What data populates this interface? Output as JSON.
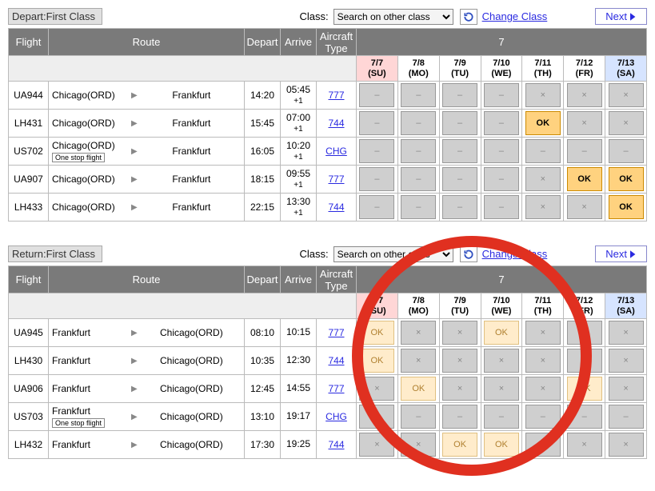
{
  "common": {
    "class_label": "Class:",
    "class_select": "Search on other class",
    "change_class": "Change Class",
    "next": "Next"
  },
  "month_header": "7",
  "dates": [
    {
      "md": "7/7",
      "dow": "(SU)",
      "cls": "date-su"
    },
    {
      "md": "7/8",
      "dow": "(MO)",
      "cls": ""
    },
    {
      "md": "7/9",
      "dow": "(TU)",
      "cls": ""
    },
    {
      "md": "7/10",
      "dow": "(WE)",
      "cls": ""
    },
    {
      "md": "7/11",
      "dow": "(TH)",
      "cls": ""
    },
    {
      "md": "7/12",
      "dow": "(FR)",
      "cls": ""
    },
    {
      "md": "7/13",
      "dow": "(SA)",
      "cls": "date-sa"
    }
  ],
  "headers": {
    "flight": "Flight",
    "route": "Route",
    "depart": "Depart",
    "arrive": "Arrive",
    "actype": "Aircraft\nType"
  },
  "depart": {
    "title": "Depart:First Class",
    "rows": [
      {
        "fl": "UA944",
        "from": "Chicago(ORD)",
        "one_stop": false,
        "to": "Frankfurt",
        "dep": "14:20",
        "arr": "05:45",
        "plus": "+1",
        "ac": "777",
        "cells": [
          "-",
          "-",
          "-",
          "-",
          "x",
          "x",
          "x"
        ]
      },
      {
        "fl": "LH431",
        "from": "Chicago(ORD)",
        "one_stop": false,
        "to": "Frankfurt",
        "dep": "15:45",
        "arr": "07:00",
        "plus": "+1",
        "ac": "744",
        "cells": [
          "-",
          "-",
          "-",
          "-",
          "OK!",
          "x",
          "x"
        ]
      },
      {
        "fl": "US702",
        "from": "Chicago(ORD)",
        "one_stop": true,
        "to": "Frankfurt",
        "dep": "16:05",
        "arr": "10:20",
        "plus": "+1",
        "ac": "CHG",
        "cells": [
          "-",
          "-",
          "-",
          "-",
          "-",
          "-",
          "-"
        ]
      },
      {
        "fl": "UA907",
        "from": "Chicago(ORD)",
        "one_stop": false,
        "to": "Frankfurt",
        "dep": "18:15",
        "arr": "09:55",
        "plus": "+1",
        "ac": "777",
        "cells": [
          "-",
          "-",
          "-",
          "-",
          "x",
          "OK!",
          "OK!"
        ]
      },
      {
        "fl": "LH433",
        "from": "Chicago(ORD)",
        "one_stop": false,
        "to": "Frankfurt",
        "dep": "22:15",
        "arr": "13:30",
        "plus": "+1",
        "ac": "744",
        "cells": [
          "-",
          "-",
          "-",
          "-",
          "x",
          "x",
          "OK!"
        ]
      }
    ]
  },
  "return": {
    "title": "Return:First Class",
    "rows": [
      {
        "fl": "UA945",
        "from": "Frankfurt",
        "one_stop": false,
        "to": "Chicago(ORD)",
        "dep": "08:10",
        "arr": "10:15",
        "plus": "",
        "ac": "777",
        "cells": [
          "OK",
          "x",
          "x",
          "OK",
          "x",
          "x",
          "x"
        ]
      },
      {
        "fl": "LH430",
        "from": "Frankfurt",
        "one_stop": false,
        "to": "Chicago(ORD)",
        "dep": "10:35",
        "arr": "12:30",
        "plus": "",
        "ac": "744",
        "cells": [
          "OK",
          "x",
          "x",
          "x",
          "x",
          "x",
          "x"
        ]
      },
      {
        "fl": "UA906",
        "from": "Frankfurt",
        "one_stop": false,
        "to": "Chicago(ORD)",
        "dep": "12:45",
        "arr": "14:55",
        "plus": "",
        "ac": "777",
        "cells": [
          "x",
          "OK",
          "x",
          "x",
          "x",
          "OK",
          "x"
        ]
      },
      {
        "fl": "US703",
        "from": "Frankfurt",
        "one_stop": true,
        "to": "Chicago(ORD)",
        "dep": "13:10",
        "arr": "19:17",
        "plus": "",
        "ac": "CHG",
        "cells": [
          "-",
          "-",
          "-",
          "-",
          "-",
          "-",
          "-"
        ]
      },
      {
        "fl": "LH432",
        "from": "Frankfurt",
        "one_stop": false,
        "to": "Chicago(ORD)",
        "dep": "17:30",
        "arr": "19:25",
        "plus": "",
        "ac": "744",
        "cells": [
          "x",
          "x",
          "OK",
          "OK",
          "x",
          "x",
          "x"
        ]
      }
    ]
  },
  "one_stop_label": "One stop flight"
}
